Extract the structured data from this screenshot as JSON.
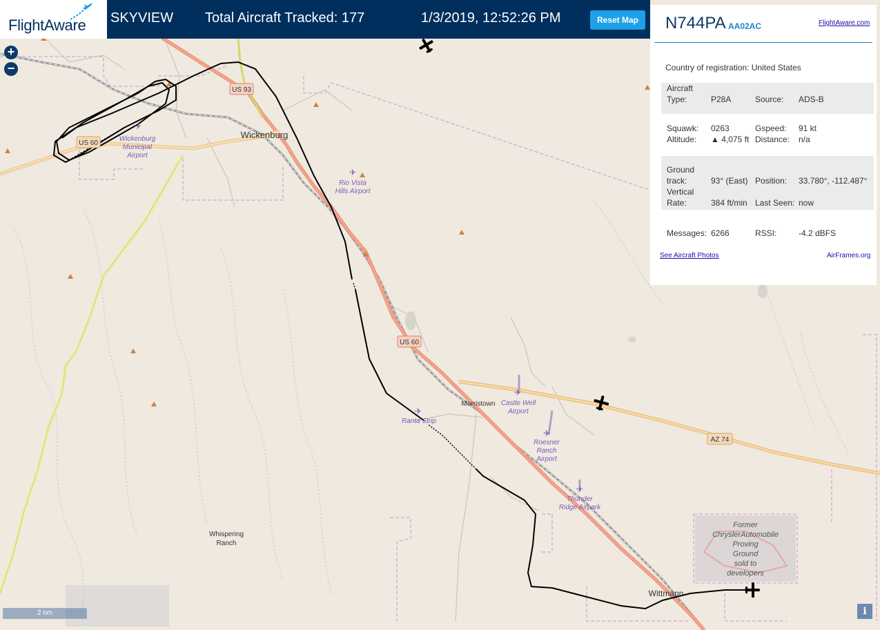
{
  "header": {
    "logo_text": "FlightAware",
    "app_name": "SKYVIEW",
    "total_tracked": "Total Aircraft Tracked: 177",
    "datetime": "1/3/2019, 12:52:26 PM",
    "reset_label": "Reset Map"
  },
  "zoom": {
    "in": "+",
    "out": "−"
  },
  "aircraft": {
    "registration": "N744PA",
    "icao": "AA02AC",
    "fa_link": "FlightAware.com",
    "country": "Country of registration: United States",
    "type_label": "Aircraft Type:",
    "type_label_l1": "Aircraft",
    "type_label_l2": "Type:",
    "type": "P28A",
    "source_label": "Source:",
    "source": "ADS-B",
    "squawk_label": "Squawk:",
    "squawk": "0263",
    "gspeed_label": "Gspeed:",
    "gspeed": "91 kt",
    "altitude_label": "Altitude:",
    "altitude": "▲ 4,075 ft",
    "distance_label": "Distance:",
    "distance": "n/a",
    "ground_track_l1": "Ground",
    "ground_track_l2": "track:",
    "ground_track": "93° (East)",
    "position_label": "Position:",
    "position": "33.780°, -112.487°",
    "vertical_rate_l1": "Vertical",
    "vertical_rate_l2": "Rate:",
    "vertical_rate": "384 ft/min",
    "last_seen_label": "Last Seen:",
    "last_seen": "now",
    "messages_label": "Messages:",
    "messages": "6266",
    "rssi_label": "RSSI:",
    "rssi": "-4.2 dBFS",
    "photos_link": "See Aircraft Photos",
    "airframes_link": "AirFrames.org"
  },
  "map": {
    "scale": "2 nm",
    "info": "i",
    "labels": {
      "wickenburg": "Wickenburg",
      "us93": "US 93",
      "us60_a": "US 60",
      "us60_b": "US 60",
      "az74": "AZ 74",
      "wick_airport_1": "Wickenburg",
      "wick_airport_2": "Municipal",
      "wick_airport_3": "Airport",
      "rio_1": "Rio Vista",
      "rio_2": "Hills Airport",
      "morristown": "Morristown",
      "castle_1": "Castle Well",
      "castle_2": "Airport",
      "ranta": "Ranta Strip",
      "roesner_1": "Roesner",
      "roesner_2": "Ranch",
      "roesner_3": "Airport",
      "thunder_1": "Thunder",
      "thunder_2": "Ridge Airpark",
      "whisper_1": "Whispering",
      "whisper_2": "Ranch",
      "chrysler_1": "Former",
      "chrysler_2": "ChryslerAutomobile",
      "chrysler_3": "Proving",
      "chrysler_4": "Ground",
      "chrysler_5": "sold to",
      "chrysler_6": "developers",
      "wittmann": "Wittmann"
    }
  }
}
